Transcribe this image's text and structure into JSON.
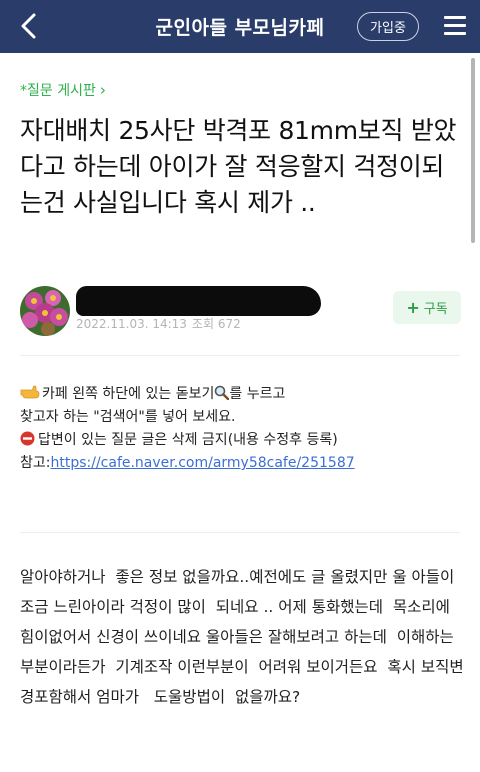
{
  "header": {
    "title": "군인아들 부모님카페",
    "join_label": "가입중",
    "bg_color": "#2a3d6a"
  },
  "post": {
    "board_label": "*질문 게시판",
    "title": "자대배치 25사단 박격포 81mm보직 받았다고 하는데 아이가 잘 적응할지 걱정이되는건 사실입니다 혹시 제가 ..",
    "author": {
      "date": "2022.11.03. 14:13",
      "views_label": "조회 672"
    },
    "subscribe_label": "구독",
    "notice": {
      "line1_a": "카페 왼쪽 하단에 있는 돋보기",
      "line1_b": "를 누르고",
      "line2": "찾고자 하는 \"검색어\"를 넣어 보세요.",
      "line3": "답변이 있는 질문 글은 삭제 금지(내용 수정후 등록)",
      "line4_prefix": "참고:",
      "link": "https://cafe.naver.com/army58cafe/251587"
    },
    "body": "알아야하거나  좋은 정보 없을까요..예전에도 글 올렸지만 울 아들이  조금 느린아이라 걱정이 많이  되네요 .. 어제 통화했는데  목소리에 힘이없어서 신경이 쓰이네요 울아들은 잘해보려고 하는데  이해하는부분이라든가  기계조작 이런부분이  어려워 보이거든요  혹시 보직변경포함해서 엄마가   도울방법이  없을까요?"
  },
  "colors": {
    "accent_green": "#2bb24c",
    "link_blue": "#3b6fd8"
  },
  "icons": [
    "back-arrow-icon",
    "hamburger-menu-icon",
    "pointing-hand-icon",
    "magnifier-icon",
    "no-entry-icon",
    "plus-icon",
    "chevron-right-icon"
  ]
}
